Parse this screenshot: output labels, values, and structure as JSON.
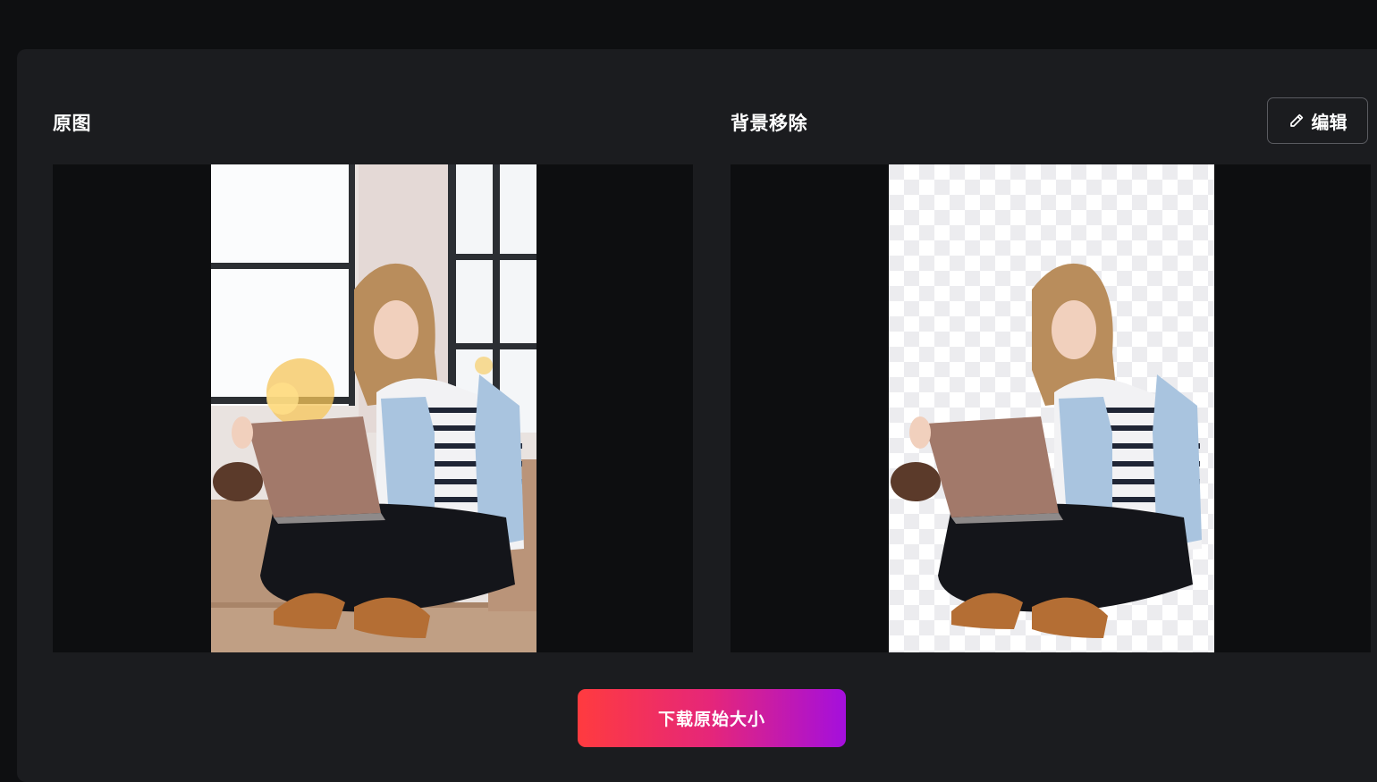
{
  "original_panel": {
    "title": "原图",
    "image": "woman-with-laptop-photo"
  },
  "result_panel": {
    "title": "背景移除",
    "image": "woman-with-laptop-cutout-transparent",
    "edit_button": {
      "icon": "pencil-icon",
      "label": "编辑"
    }
  },
  "download_button": {
    "label": "下载原始大小"
  },
  "colors": {
    "page_background": "#0e0f11",
    "card_background": "#1b1c1f",
    "image_well": "#0d0e10",
    "button_gradient": [
      "#ff3b3f",
      "#e5267a",
      "#a40fdd"
    ]
  }
}
